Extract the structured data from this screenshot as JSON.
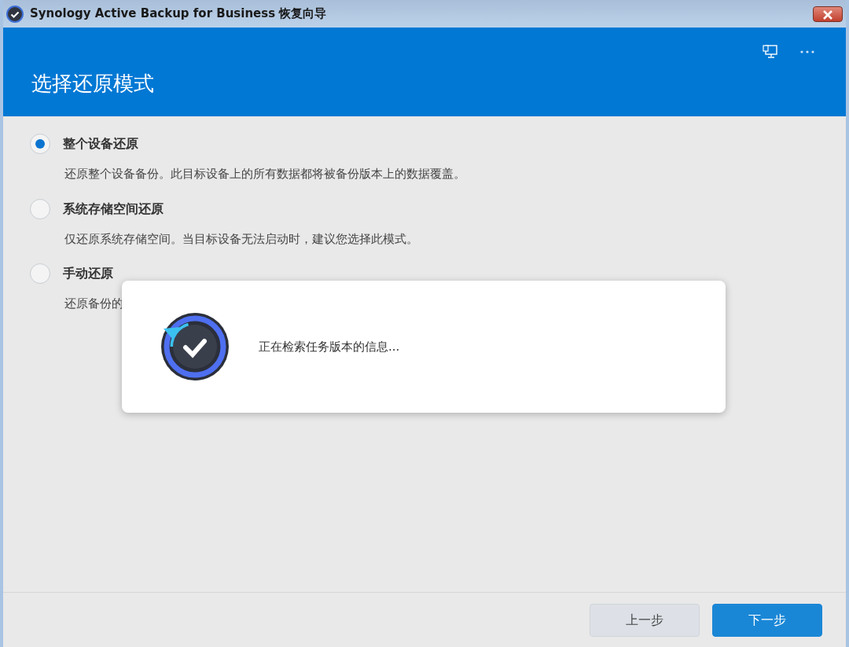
{
  "window": {
    "title": "Synology Active Backup for Business 恢复向导"
  },
  "header": {
    "title": "选择还原模式"
  },
  "options": [
    {
      "label": "整个设备还原",
      "description": "还原整个设备备份。此目标设备上的所有数据都将被备份版本上的数据覆盖。",
      "selected": true
    },
    {
      "label": "系统存储空间还原",
      "description": "仅还原系统存储空间。当目标设备无法启动时，建议您选择此模式。",
      "selected": false
    },
    {
      "label": "手动还原",
      "description": "还原备份的",
      "selected": false
    }
  ],
  "dialog": {
    "message": "正在检索任务版本的信息..."
  },
  "buttons": [
    {
      "label": "上一步",
      "kind": "secondary"
    },
    {
      "label": "下一步",
      "kind": "primary"
    }
  ]
}
